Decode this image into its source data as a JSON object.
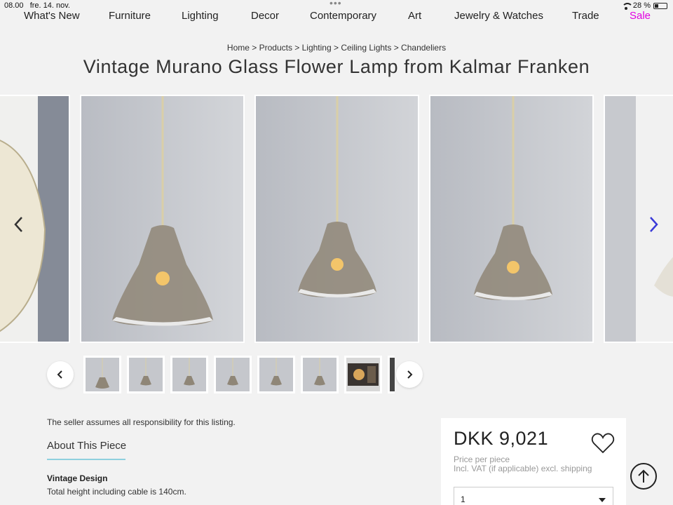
{
  "status_bar": {
    "time": "08.00",
    "date": "fre. 14. nov.",
    "battery": "28 %"
  },
  "nav": {
    "items": [
      "What's New",
      "Furniture",
      "Lighting",
      "Decor",
      "Contemporary",
      "Art",
      "Jewelry & Watches",
      "Trade"
    ],
    "sale": "Sale",
    "sale_color": "#e100e1"
  },
  "breadcrumb": "Home > Products > Lighting > Ceiling Lights > Chandeliers",
  "title": "Vintage Murano Glass Flower Lamp from Kalmar Franken",
  "gallery": {
    "prev_icon": "chevron-left-icon",
    "next_icon": "chevron-right-icon",
    "next_color": "#3a3ad8"
  },
  "about": {
    "seller_note": "The seller assumes all responsibility for this listing.",
    "heading": "About This Piece",
    "design_label": "Vintage Design",
    "height_text": "Total height including cable is 140cm."
  },
  "purchase": {
    "price": "DKK 9,021",
    "per_piece": "Price per piece",
    "vat_note": "Incl. VAT (if applicable) excl. shipping",
    "quantity": "1",
    "heart_icon": "heart-icon"
  },
  "accent_colors": {
    "about_underline": "#8ed0de"
  }
}
